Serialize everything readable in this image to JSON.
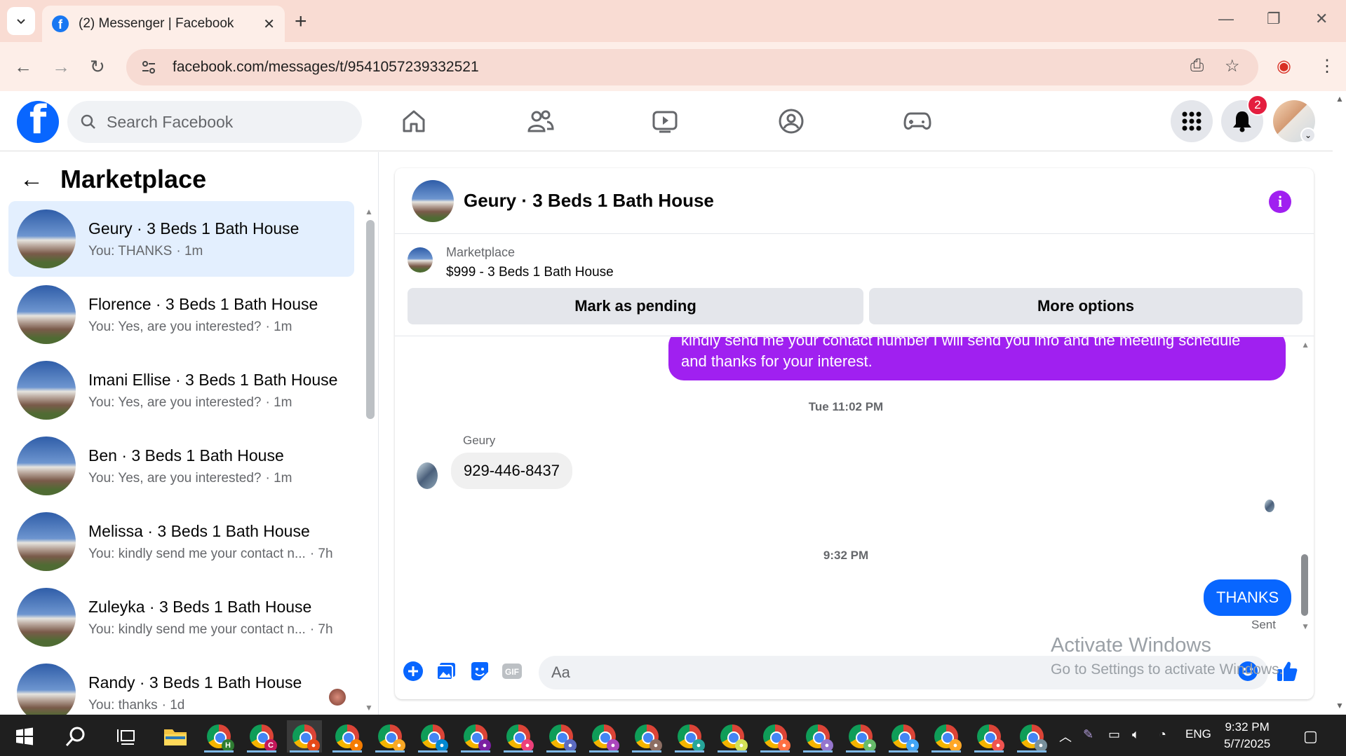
{
  "browser": {
    "tab_title": "(2) Messenger | Facebook",
    "url": "facebook.com/messages/t/9541057239332521"
  },
  "fb": {
    "search_placeholder": "Search Facebook",
    "notif_count": "2",
    "brand_color": "#0866ff"
  },
  "left": {
    "title": "Marketplace",
    "conversations": [
      {
        "name": "Geury · 3 Beds 1 Bath House",
        "preview": "You: THANKS",
        "time": "· 1m"
      },
      {
        "name": "Florence · 3 Beds 1 Bath House",
        "preview": "You: Yes, are you interested?",
        "time": "· 1m"
      },
      {
        "name": "Imani Ellise · 3 Beds 1 Bath House",
        "preview": "You: Yes, are you interested?",
        "time": "· 1m"
      },
      {
        "name": "Ben · 3 Beds 1 Bath House",
        "preview": "You: Yes, are you interested?",
        "time": "· 1m"
      },
      {
        "name": "Melissa · 3 Beds 1 Bath House",
        "preview": "You: kindly send me your contact n...",
        "time": "· 7h"
      },
      {
        "name": "Zuleyka · 3 Beds 1 Bath House",
        "preview": "You: kindly send me your contact n...",
        "time": "· 7h"
      },
      {
        "name": "Randy · 3 Beds 1 Bath House",
        "preview": "You: thanks",
        "time": "· 1d"
      }
    ]
  },
  "chat": {
    "title": "Geury · 3 Beds 1 Bath House",
    "marketplace_label": "Marketplace",
    "listing": "$999 - 3 Beds 1 Bath House",
    "mark_pending": "Mark as pending",
    "more_options": "More options",
    "out_msg_line1": "kindly send me your contact number I will send you info and the meeting schedule",
    "out_msg_line2": "and thanks for your interest.",
    "stamp1": "Tue 11:02 PM",
    "sender": "Geury",
    "in_msg": "929-446-8437",
    "stamp2": "9:32 PM",
    "sent_msg": "THANKS",
    "sent_label": "Sent",
    "composer_placeholder": "Aa",
    "accent_color": "#a020f0"
  },
  "watermark": {
    "line1": "Activate Windows",
    "line2": "Go to Settings to activate Windows."
  },
  "taskbar": {
    "lang": "ENG",
    "time": "9:32 PM",
    "date": "5/7/2025"
  }
}
